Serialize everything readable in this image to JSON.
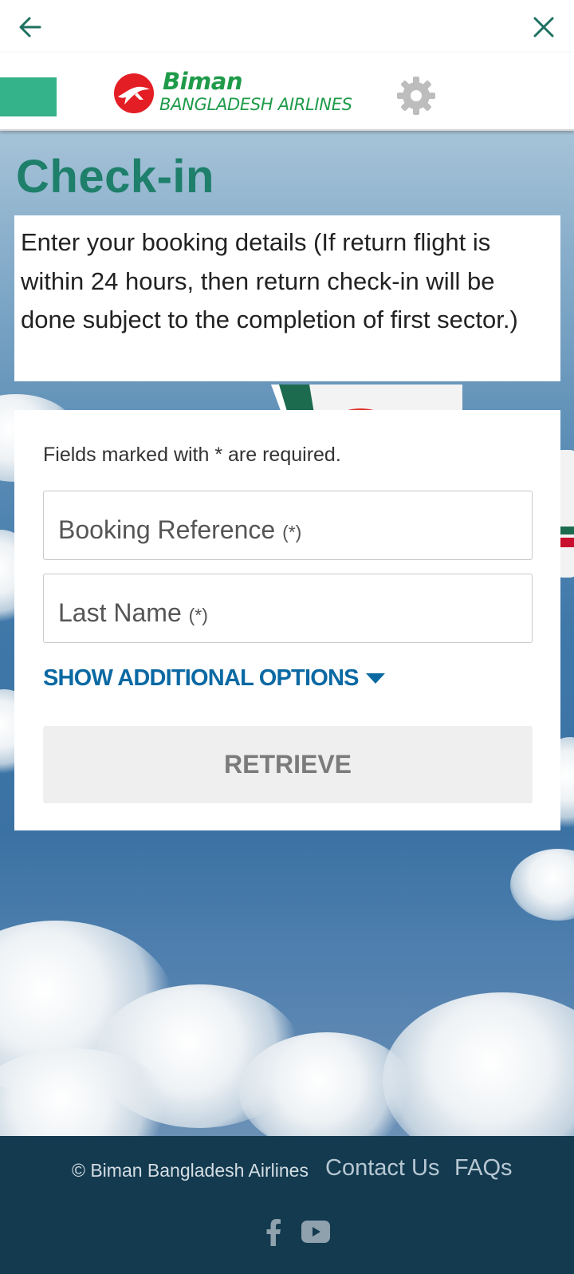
{
  "topbar": {
    "back_icon": "arrow-left-icon",
    "close_icon": "close-icon"
  },
  "header": {
    "menu_tab": "menu-tab",
    "logo_word": "Biman",
    "logo_sub": "BANGLADESH AIRLINES",
    "settings_icon": "gear-icon",
    "brand_color": "#1f9b4a",
    "accent_color": "#34b289"
  },
  "page": {
    "title": "Check-in",
    "intro": "Enter your booking details (If return flight is within 24 hours, then return check-in will be done subject to the completion of first sector.)"
  },
  "form": {
    "required_note": "Fields marked with * are required.",
    "booking_reference": {
      "label": "Booking Reference",
      "required_mark": "(*)",
      "value": ""
    },
    "last_name": {
      "label": "Last Name",
      "required_mark": "(*)",
      "value": ""
    },
    "show_options_label": "SHOW ADDITIONAL OPTIONS",
    "retrieve_label": "RETRIEVE",
    "link_color": "#0a69a3"
  },
  "footer": {
    "copyright": "© Biman Bangladesh Airlines",
    "contact_label": "Contact Us",
    "faq_label": "FAQs",
    "social_icons": [
      "facebook-icon",
      "youtube-icon"
    ],
    "background_color": "#133a4f"
  }
}
